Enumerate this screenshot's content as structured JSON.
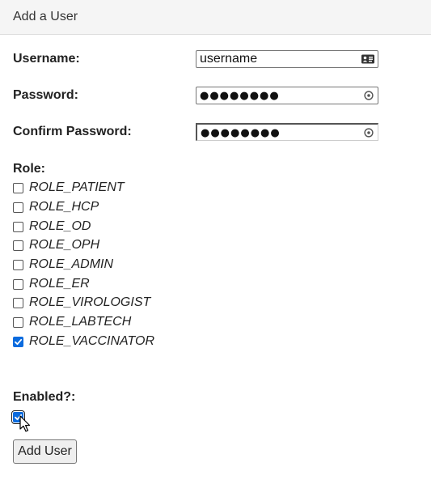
{
  "panel": {
    "title": "Add a User"
  },
  "form": {
    "username": {
      "label": "Username:",
      "value": "username"
    },
    "password": {
      "label": "Password:",
      "value": "●●●●●●●●"
    },
    "confirm_password": {
      "label": "Confirm Password:",
      "value": "●●●●●●●●"
    },
    "role": {
      "label": "Role:",
      "options": [
        {
          "label": "ROLE_PATIENT",
          "checked": false
        },
        {
          "label": "ROLE_HCP",
          "checked": false
        },
        {
          "label": "ROLE_OD",
          "checked": false
        },
        {
          "label": "ROLE_OPH",
          "checked": false
        },
        {
          "label": "ROLE_ADMIN",
          "checked": false
        },
        {
          "label": "ROLE_ER",
          "checked": false
        },
        {
          "label": "ROLE_VIROLOGIST",
          "checked": false
        },
        {
          "label": "ROLE_LABTECH",
          "checked": false
        },
        {
          "label": "ROLE_VACCINATOR",
          "checked": true
        }
      ]
    },
    "enabled": {
      "label": "Enabled?:",
      "checked": true
    },
    "submit_label": "Add User"
  },
  "icons": {
    "username_field": "contact-card-icon",
    "password_field": "key-reveal-icon",
    "cursor": "mouse-pointer-icon"
  },
  "colors": {
    "checkbox_checked": "#0b6bde",
    "heading_bg": "#f5f5f5"
  }
}
